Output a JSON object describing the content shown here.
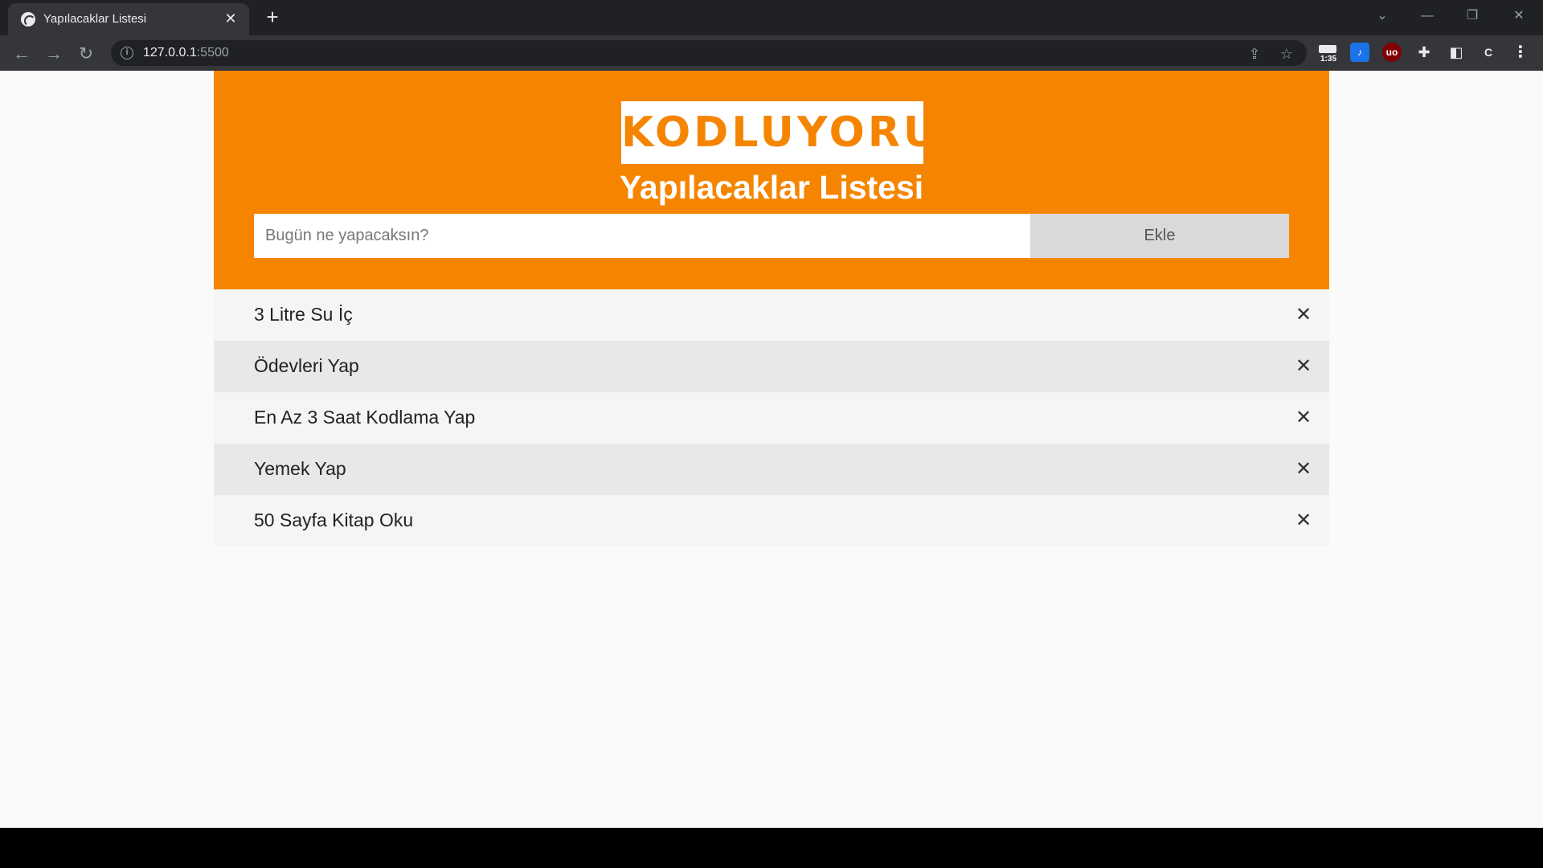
{
  "browser": {
    "tab_title": "Yapılacaklar Listesi",
    "tab_close": "✕",
    "new_tab": "+",
    "url_host": "127.0.0.1",
    "url_port": ":5500",
    "extension_time": "1:35",
    "profile_letter": "C"
  },
  "page": {
    "logo": "KODLUYORUZ",
    "title": "Yapılacaklar Listesi",
    "input_placeholder": "Bugün ne yapacaksın?",
    "add_label": "Ekle",
    "delete_glyph": "✕",
    "todos": [
      {
        "text": "3 Litre Su İç"
      },
      {
        "text": "Ödevleri Yap"
      },
      {
        "text": "En Az 3 Saat Kodlama Yap"
      },
      {
        "text": "Yemek Yap"
      },
      {
        "text": "50 Sayfa Kitap Oku"
      }
    ]
  },
  "colors": {
    "brand_orange": "#f58500",
    "chrome_dark": "#202124",
    "chrome_toolbar": "#35363a"
  }
}
